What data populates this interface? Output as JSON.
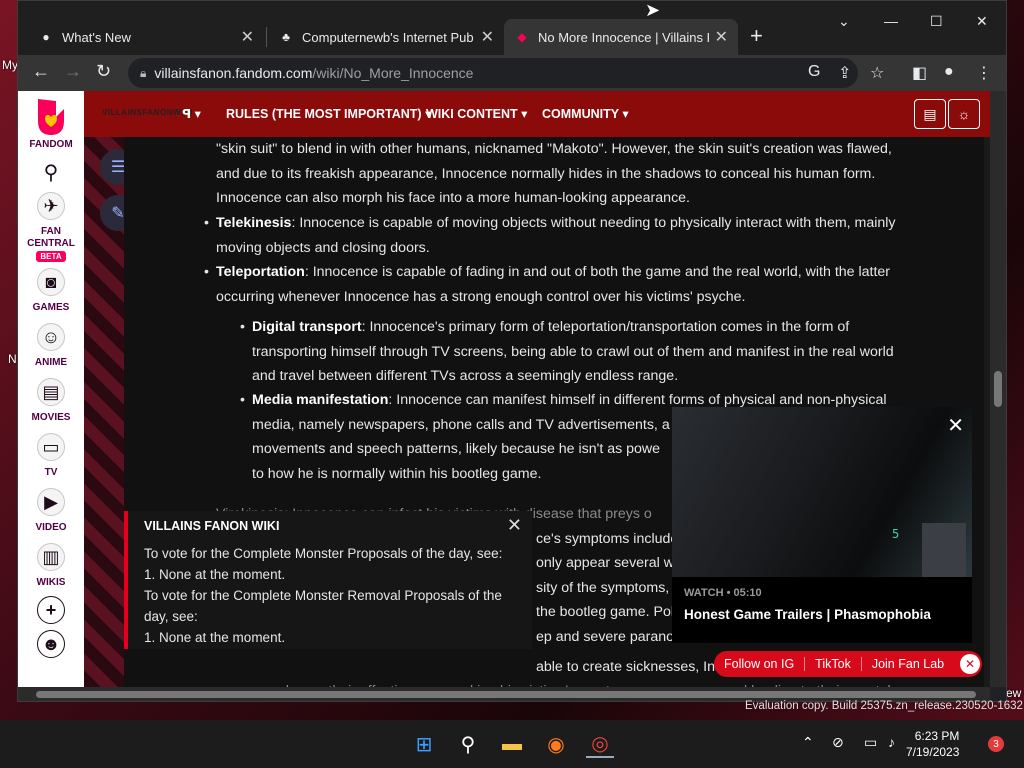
{
  "desktop": {
    "labels": [
      "My",
      "N",
      "ew"
    ]
  },
  "browser": {
    "tabs": [
      {
        "title": "What's New",
        "icon": "github-icon"
      },
      {
        "title": "Computernewb's Internet Pub H",
        "icon": "pub-icon"
      },
      {
        "title": "No More Innocence | Villains Fan",
        "icon": "fandom-icon"
      }
    ],
    "url_host": "villainsfanon.fandom.com",
    "url_path": "/wiki/No_More_Innocence"
  },
  "rail": {
    "brand": "FANDOM",
    "items": [
      {
        "label": "FAN CENTRAL",
        "badge": "BETA"
      },
      {
        "label": "GAMES"
      },
      {
        "label": "ANIME"
      },
      {
        "label": "MOVIES"
      },
      {
        "label": "TV"
      },
      {
        "label": "VIDEO"
      },
      {
        "label": "WIKIS"
      }
    ]
  },
  "wiki_header": {
    "wordmark": "VILLAINSFANONWIKI",
    "nav": [
      "RULES (THE MOST IMPORTANT)",
      "WIKI CONTENT",
      "COMMUNITY"
    ]
  },
  "article": {
    "intro_lines": [
      "\"skin suit\" to blend in with other humans, nicknamed \"Makoto\". However, the skin suit's creation was flawed,",
      "and due to its freakish appearance, Innocence normally hides in the shadows to conceal his human form.",
      "Innocence can also morph his face into a more human-looking appearance."
    ],
    "telekinesis_term": "Telekinesis",
    "telekinesis_lines": [
      ": Innocence is capable of moving objects without needing to physically interact with them, mainly",
      "moving objects and closing doors."
    ],
    "teleportation_term": "Teleportation",
    "teleportation_lines": [
      ": Innocence is capable of fading in and out of both the game and the real world, with the latter",
      "occurring whenever Innocence has a strong enough control over his victims' psyche."
    ],
    "digital_term": "Digital transport",
    "digital_lines": [
      ": Innocence's primary form of teleportation/transportation comes in the form of",
      "transporting himself through TV screens, being able to crawl out of them and manifest in the real world",
      "and travel between different TVs across a seemingly endless range."
    ],
    "media_term": "Media manifestation",
    "media_lines": [
      ": Innocence can manifest himself in different forms of physical and non-physical",
      "media, namely newspapers, phone calls and TV advertisements, a",
      "movements and speech patterns, likely because he isn't as powe",
      "to how he is normally within his bootleg game."
    ],
    "partial_lines": [
      "Virokinesis: Innocence can infect his victims with disease that preys o",
      "ce's symptoms include",
      "only appear several wee",
      "sity of the symptoms, th",
      "the bootleg game. Polic",
      "ep and severe paranoia",
      "able to create sicknesses, Inn",
      "enhance their effectiveness, making his victims' symptoms more severe and leading to their mental"
    ]
  },
  "notice": {
    "title": "VILLAINS FANON WIKI",
    "lines": [
      "To vote for the Complete Monster Proposals of the day, see:",
      "1. None at the moment.",
      "To vote for the Complete Monster Removal Proposals of the",
      "day, see:",
      "1. None at the moment."
    ]
  },
  "video": {
    "meta": "WATCH • 05:10",
    "title": "Honest Game Trailers | Phasmophobia",
    "hud_number": "5"
  },
  "social": [
    "Follow on IG",
    "TikTok",
    "Join Fan Lab"
  ],
  "watermark": "Evaluation copy. Build 25375.zn_release.230520-1632",
  "taskbar": {
    "time": "6:23 PM",
    "date": "7/19/2023",
    "notifications": "3"
  }
}
